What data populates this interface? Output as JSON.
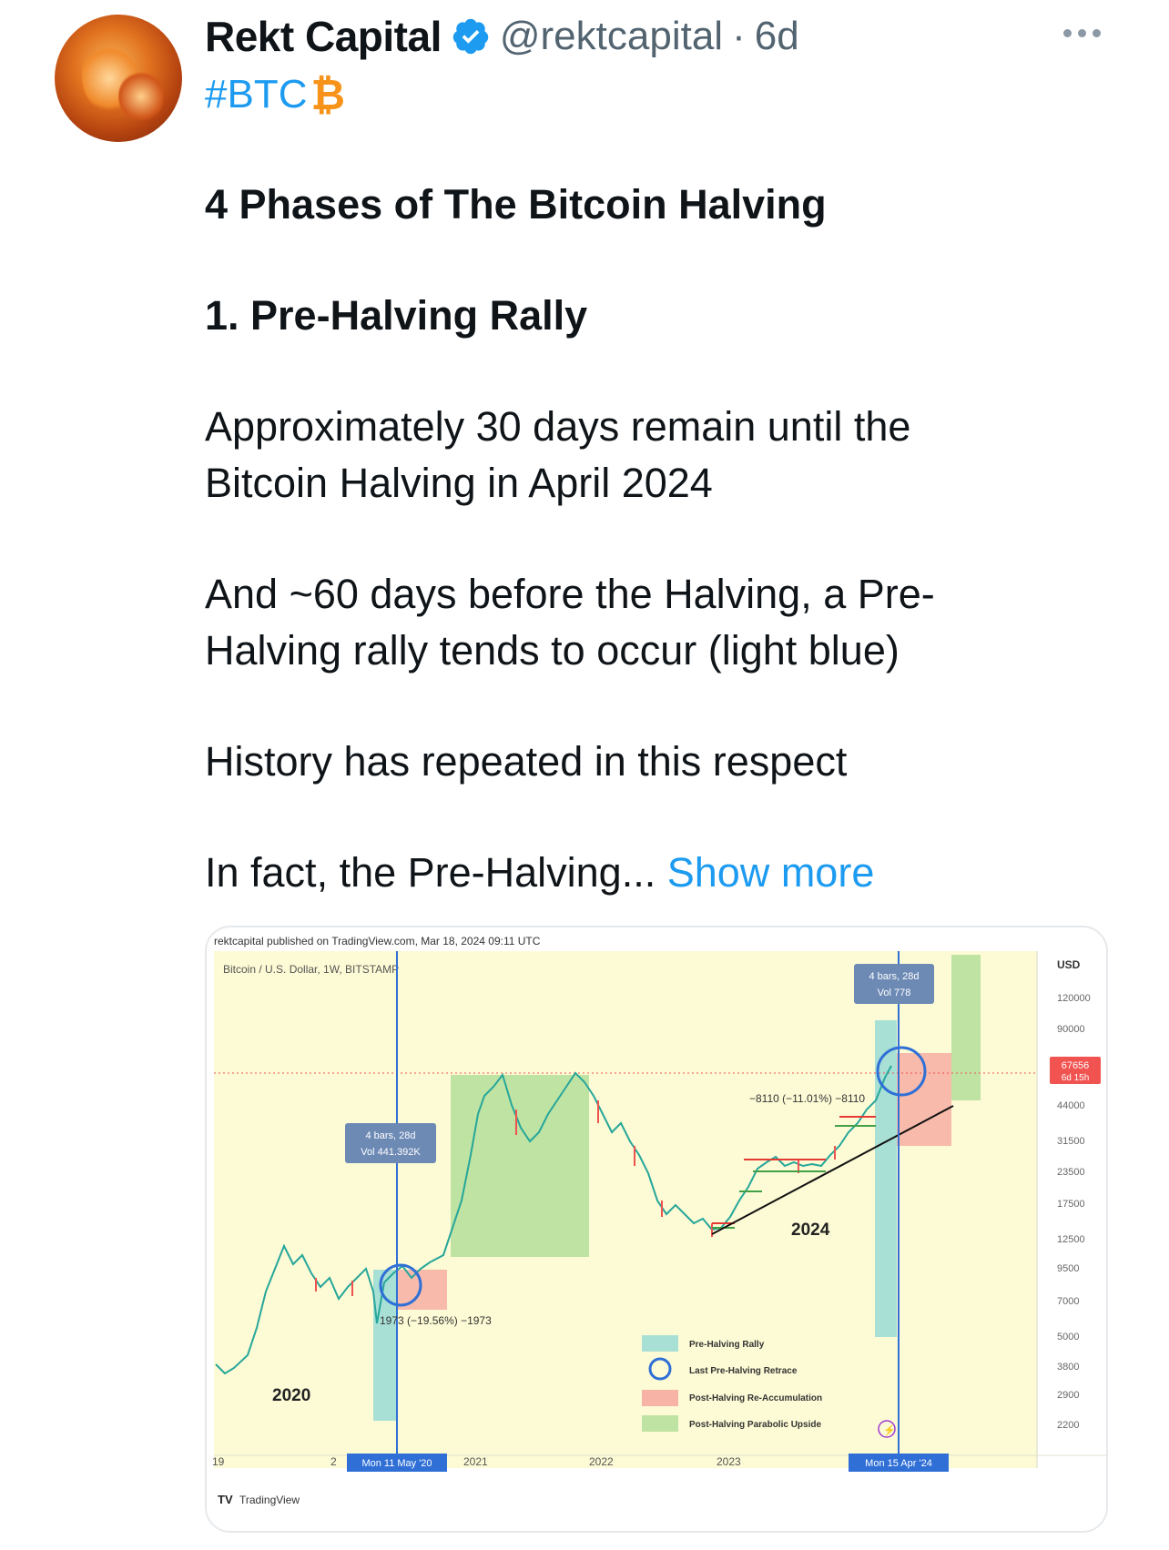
{
  "tweet": {
    "display_name": "Rekt Capital",
    "handle": "@rektcapital",
    "separator": "·",
    "time": "6d",
    "hashtag": "#BTC",
    "hashtag_glyph": "₿",
    "title": "4 Phases of The Bitcoin Halving",
    "subtitle": "1. Pre-Halving Rally",
    "para1_line1": "Approximately 30 days remain until the",
    "para1_line2": "Bitcoin Halving in April 2024",
    "para2_line1": "And ~60 days before the Halving, a Pre-",
    "para2_line2": "Halving rally tends to occur (light blue)",
    "para3": "History has repeated in this respect",
    "para4": "In fact, the Pre-Halving...",
    "show_more": "Show more",
    "icons": {
      "verified": "verified-badge-icon",
      "more": "more-options-icon"
    },
    "colors": {
      "link": "#1d9bf0",
      "verified": "#1d9bf0",
      "btc": "#f7931a"
    }
  },
  "chart": {
    "published": "rektcapital published on TradingView.com, Mar 18, 2024 09:11 UTC",
    "symbol": "Bitcoin / U.S. Dollar, 1W, BITSTAMP",
    "currency": "USD",
    "price_ticks": [
      "120000",
      "90000",
      "44000",
      "31500",
      "23500",
      "17500",
      "12500",
      "9500",
      "7000",
      "5000",
      "3800",
      "2900",
      "2200"
    ],
    "current_price": "67656",
    "current_price_sub": "6d 15h",
    "x_ticks": [
      "19",
      "2",
      "2021",
      "2022",
      "2023"
    ],
    "cursor_label_1": "Mon 11 May '20",
    "cursor_label_2": "Mon 15 Apr '24",
    "tooltip1_line1": "4 bars, 28d",
    "tooltip1_line2": "Vol 441.392K",
    "tooltip2_line1": "4 bars, 28d",
    "tooltip2_line2": "Vol 778",
    "measure1": "1973 (−19.56%) −1973",
    "measure2": "−8110 (−11.01%) −8110",
    "year_label_1": "2020",
    "year_label_2": "2024",
    "legend": [
      {
        "label": "Pre-Halving Rally",
        "color": "#a8e0d6"
      },
      {
        "label": "Last Pre-Halving Retrace",
        "color": "#2f6fd6"
      },
      {
        "label": "Post-Halving Re-Accumulation",
        "color": "#f6b3a6"
      },
      {
        "label": "Post-Halving Parabolic Upside",
        "color": "#bfe3a3"
      }
    ],
    "watermark": "TradingView",
    "colors": {
      "background": "#fdfbd5",
      "pre_halving": "#a8e0d6",
      "post_reaccum": "#f6b3a6",
      "post_parabolic": "#bfe3a3",
      "cursor": "#2f6fd6",
      "price_tag": "#f05350"
    }
  }
}
